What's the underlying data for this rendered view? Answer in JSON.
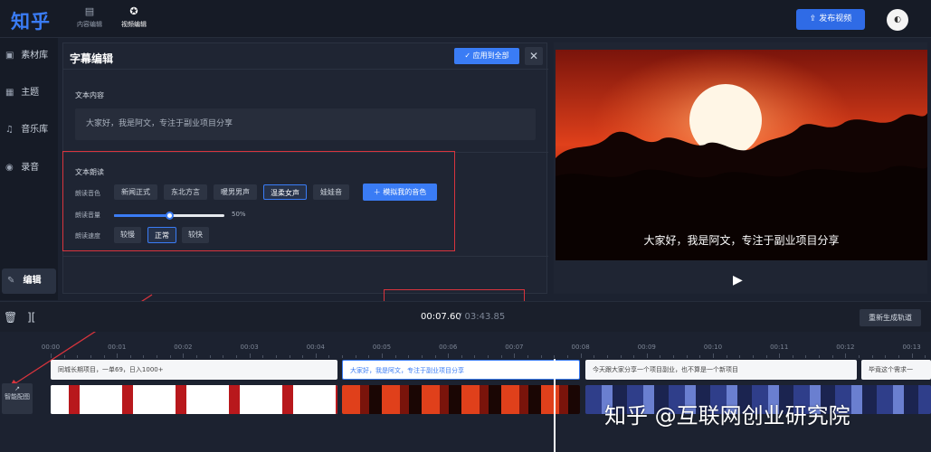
{
  "app": {
    "logo": "知乎",
    "nav": [
      {
        "label": "内容编辑",
        "icon": "doc-icon"
      },
      {
        "label": "视频编辑",
        "icon": "film-reel-icon"
      }
    ],
    "publish_label": "发布视频",
    "avatar_icon": "avatar"
  },
  "sidebar": {
    "items": [
      {
        "label": "素材库",
        "icon": "box-icon"
      },
      {
        "label": "主题",
        "icon": "grid-icon"
      },
      {
        "label": "音乐库",
        "icon": "music-icon"
      },
      {
        "label": "录音",
        "icon": "mic-icon"
      },
      {
        "label": "编辑",
        "icon": "edit-icon"
      }
    ]
  },
  "editor": {
    "title": "字幕编辑",
    "apply_all_label": "应用到全部",
    "close_glyph": "✕",
    "text_content_label": "文本内容",
    "text_content_value": "大家好，我是阿文，专注于副业项目分享",
    "tts": {
      "section_label": "文本朗读",
      "voice_label": "朗读音色",
      "voices": [
        "新闻正式",
        "东北方言",
        "暖男男声",
        "温柔女声",
        "娃娃音"
      ],
      "selected_voice": "温柔女声",
      "clone_label": "模拟我的音色",
      "volume_label": "朗读音量",
      "volume_percent": 50,
      "volume_text": "50%",
      "speed_label": "朗读速度",
      "speeds": [
        "较慢",
        "正常",
        "较快"
      ],
      "selected_speed": "正常"
    }
  },
  "preview": {
    "subtitle": "大家好，我是阿文，专注于副业项目分享",
    "play_icon": "play-icon"
  },
  "timeline": {
    "current_time": "00:07.60",
    "total_time": "/ 03:43.85",
    "regen_label": "重新生成轨道",
    "smart_label": "智能配图",
    "ticks": [
      "00:00",
      "00:01",
      "00:02",
      "00:03",
      "00:04",
      "00:05",
      "00:06",
      "00:07",
      "00:08",
      "00:09",
      "00:10",
      "00:11",
      "00:12",
      "00:13"
    ],
    "subtitle_clips": [
      "同城长期项目，一单69，日入1000+",
      "大家好，我是阿文，专注于副业项目分享",
      "今天跟大家分享一个项目副业，也不算是一个新项目",
      "毕竟这个需求一"
    ]
  },
  "watermark": "知乎 @互联网创业研究院",
  "colors": {
    "accent": "#3a7cf5",
    "highlight_red": "#d8343d",
    "background": "#1c2230"
  }
}
